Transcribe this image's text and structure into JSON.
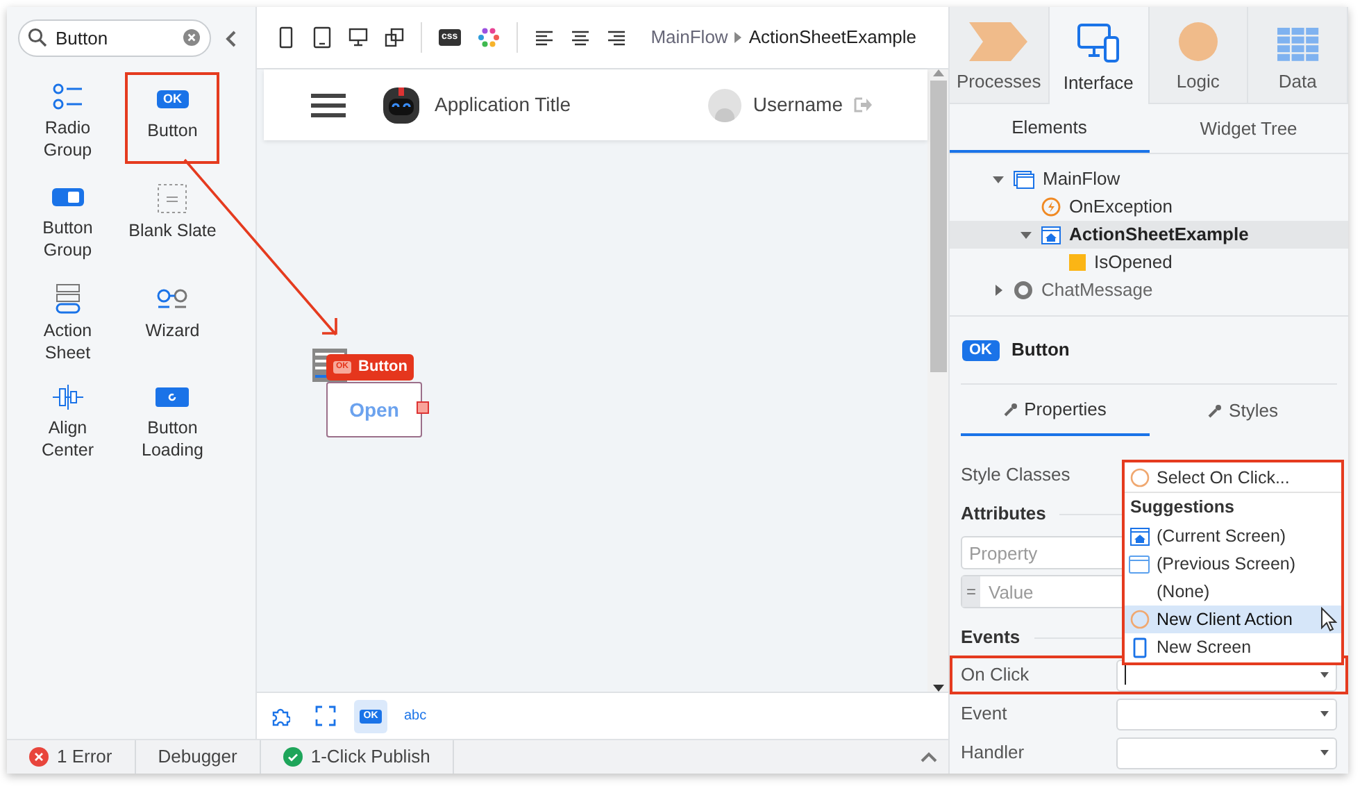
{
  "search": {
    "value": "Button"
  },
  "palette": [
    {
      "label": "Radio Group",
      "kind": "radio",
      "highlighted": false
    },
    {
      "label": "Button Group",
      "kind": "button-group",
      "highlighted": false
    },
    {
      "label": "Action Sheet",
      "kind": "action-sheet",
      "highlighted": false
    },
    {
      "label": "Align Center",
      "kind": "align",
      "highlighted": false
    },
    {
      "label": "Button",
      "kind": "button",
      "badge": "OK",
      "highlighted": true
    },
    {
      "label": "Blank Slate",
      "kind": "blank",
      "highlighted": false
    },
    {
      "label": "Wizard",
      "kind": "wizard",
      "highlighted": false
    },
    {
      "label": "Button Loading",
      "kind": "loading",
      "highlighted": false
    }
  ],
  "toolbar": {
    "css_icon_text": "css"
  },
  "breadcrumb": {
    "parent": "MainFlow",
    "current": "ActionSheetExample"
  },
  "preview": {
    "app_title": "Application Title",
    "username": "Username"
  },
  "widget": {
    "tag": "Button",
    "tag_badge": "OK",
    "label": "Open"
  },
  "canvas_tools": [
    {
      "kind": "puzzle",
      "selected": false
    },
    {
      "kind": "frame",
      "selected": false
    },
    {
      "kind": "ok",
      "label": "OK",
      "selected": true
    },
    {
      "kind": "text",
      "label": "abc",
      "selected": false
    }
  ],
  "status_bar": [
    {
      "label": "1 Error",
      "kind": "error"
    },
    {
      "label": "Debugger",
      "kind": "plain"
    },
    {
      "label": "1-Click Publish",
      "kind": "success"
    }
  ],
  "app_tabs": [
    {
      "label": "Processes",
      "kind": "processes",
      "selected": false
    },
    {
      "label": "Interface",
      "kind": "interface",
      "selected": true
    },
    {
      "label": "Logic",
      "kind": "logic",
      "selected": false
    },
    {
      "label": "Data",
      "kind": "data",
      "selected": false
    }
  ],
  "panel_tabs": [
    {
      "label": "Elements",
      "selected": true
    },
    {
      "label": "Widget Tree",
      "selected": false
    }
  ],
  "tree": [
    {
      "label": "MainFlow",
      "kind": "flow",
      "expanded": true,
      "selected": false,
      "children": [
        {
          "label": "OnException",
          "kind": "exception",
          "selected": false
        },
        {
          "label": "ActionSheetExample",
          "kind": "screen",
          "expanded": true,
          "selected": true,
          "children": [
            {
              "label": "IsOpened",
              "kind": "variable",
              "selected": false
            }
          ]
        }
      ]
    },
    {
      "label": "ChatMessage",
      "kind": "block",
      "expanded": false,
      "selected": false
    }
  ],
  "selection": {
    "badge": "OK",
    "name": "Button"
  },
  "props_tabs": [
    {
      "label": "Properties",
      "selected": true
    },
    {
      "label": "Styles",
      "selected": false
    }
  ],
  "properties": {
    "style_classes_label": "Style Classes",
    "attributes_heading": "Attributes",
    "property_placeholder": "Property",
    "value_prefix": "=",
    "value_placeholder": "Value",
    "events_heading": "Events",
    "events": [
      {
        "label": "On Click",
        "highlighted": true
      },
      {
        "label": "Event",
        "highlighted": false
      },
      {
        "label": "Handler",
        "highlighted": false
      }
    ]
  },
  "dropdown": {
    "items": [
      {
        "label": "Select On Click...",
        "kind": "circle",
        "hovered": false
      },
      {
        "label": "Suggestions",
        "kind": "heading"
      },
      {
        "label": "(Current Screen)",
        "kind": "screen",
        "hovered": false
      },
      {
        "label": "(Previous Screen)",
        "kind": "window",
        "hovered": false
      },
      {
        "label": "(None)",
        "kind": "none",
        "hovered": false
      },
      {
        "label": "New Client Action",
        "kind": "circle",
        "hovered": true
      },
      {
        "label": "New Screen",
        "kind": "phone",
        "hovered": false
      }
    ]
  }
}
